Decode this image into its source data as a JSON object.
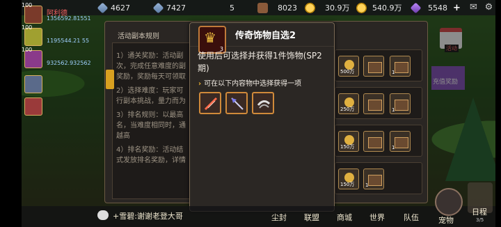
{
  "topbar": {
    "resources": [
      {
        "icon": "gem-icon",
        "value": "4627"
      },
      {
        "icon": "gem-icon",
        "value": "7427"
      },
      {
        "icon": "box-icon",
        "value": "5"
      },
      {
        "icon": "box-icon",
        "value": "8023"
      },
      {
        "icon": "gold-icon",
        "value": "30.9万"
      },
      {
        "icon": "gold-icon",
        "value": "540.9万"
      },
      {
        "icon": "diamond-icon",
        "value": "5548"
      }
    ],
    "plus_label": "+"
  },
  "players": [
    {
      "level": "100",
      "name": "阿利德",
      "power": "1356592.81551"
    },
    {
      "level": "100",
      "name": "",
      "power": "1195544.21 55"
    },
    {
      "level": "100",
      "name": "",
      "power": "932562.932562"
    },
    {
      "level": "",
      "name": "",
      "power": ""
    },
    {
      "level": "",
      "name": "",
      "power": ""
    }
  ],
  "rules_panel": {
    "title": "活动副本规则",
    "lines": [
      "1）通关奖励：活动副",
      "次，完成任意难度的副",
      "奖励，奖励每天可领取",
      "2）选择难度：玩家可",
      "行副本挑战，量力而为",
      "3）排名规则：以最高",
      "名，当难度相同时，通",
      "越高",
      "4）排名奖励：活动结",
      "式发放排名奖励，详情"
    ],
    "rewards": [
      {
        "amount": "500万",
        "count": "1"
      },
      {
        "amount": "250万",
        "count": "1"
      },
      {
        "amount": "150万",
        "count": "1"
      },
      {
        "amount": "150万",
        "count": "1"
      }
    ]
  },
  "popup": {
    "item_qty": "3",
    "title": "传奇饰物自选2",
    "description": "使用后可选择并获得1件饰物(SP2期)",
    "sub_label": "可在以下内容物中选择获得一项",
    "options": [
      {
        "icon": "feather-quill-icon"
      },
      {
        "icon": "spear-icon"
      },
      {
        "icon": "claw-icon"
      }
    ]
  },
  "chat": {
    "text": "+雪碧:谢谢老登大哥"
  },
  "nav": {
    "items": [
      "尘封",
      "联盟",
      "商城",
      "世界",
      "队伍"
    ],
    "pet_label": "宠物",
    "schedule_label": "日程",
    "schedule_sub": "3/5"
  },
  "side": {
    "calendar_label": "活动",
    "banner_text": "充值奖励"
  }
}
